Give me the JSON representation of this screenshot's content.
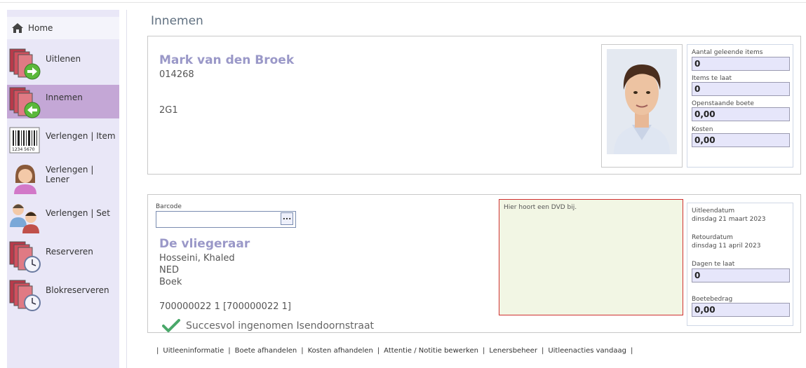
{
  "sidebar": {
    "home_label": "Home",
    "items": [
      {
        "label": "Uitlenen",
        "icon": "books-arrow-right-icon"
      },
      {
        "label": "Innemen",
        "icon": "books-arrow-left-icon",
        "active": true
      },
      {
        "label": "Verlengen | Item",
        "icon": "barcode-icon"
      },
      {
        "label": "Verlengen | Lener",
        "icon": "female-user-icon"
      },
      {
        "label": "Verlengen | Set",
        "icon": "users-group-icon"
      },
      {
        "label": "Reserveren",
        "icon": "books-clock-icon"
      },
      {
        "label": "Blokreserveren",
        "icon": "books-clock-icon"
      }
    ]
  },
  "page": {
    "title": "Innemen"
  },
  "borrower": {
    "name": "Mark van den Broek",
    "number": "014268",
    "group": "2G1"
  },
  "borrower_stats": {
    "items_label": "Aantal geleende items",
    "items_value": "0",
    "late_label": "Items te laat",
    "late_value": "0",
    "fine_label": "Openstaande boete",
    "fine_value": "0,00",
    "costs_label": "Kosten",
    "costs_value": "0,00"
  },
  "item": {
    "barcode_label": "Barcode",
    "barcode_value": "",
    "barcode_button": "...",
    "title": "De vliegeraar",
    "author": "Hosseini, Khaled",
    "language": "NED",
    "type": "Boek",
    "copy": "700000022 1 [700000022 1]",
    "note": "Hier hoort een DVD bij.",
    "success_message": "Succesvol ingenomen Isendoornstraat"
  },
  "loan_stats": {
    "loan_date_label": "Uitleendatum",
    "loan_date_value": "dinsdag 21 maart 2023",
    "return_date_label": "Retourdatum",
    "return_date_value": "dinsdag 11 april 2023",
    "days_late_label": "Dagen te laat",
    "days_late_value": "0",
    "fine_amount_label": "Boetebedrag",
    "fine_amount_value": "0,00"
  },
  "footer": {
    "links": [
      "Uitleeninformatie",
      "Boete afhandelen",
      "Kosten afhandelen",
      "Attentie / Notitie bewerken",
      "Lenersbeheer",
      "Uitleenacties vandaag"
    ]
  },
  "colors": {
    "sidebar_bg": "#e9e7f7",
    "active_item": "#c4a7d6",
    "name_accent": "#9a98c8",
    "field_bg": "#e6e6fa",
    "note_bg": "#f2f6e4",
    "note_border": "#d03030",
    "success": "#4aa86a"
  }
}
